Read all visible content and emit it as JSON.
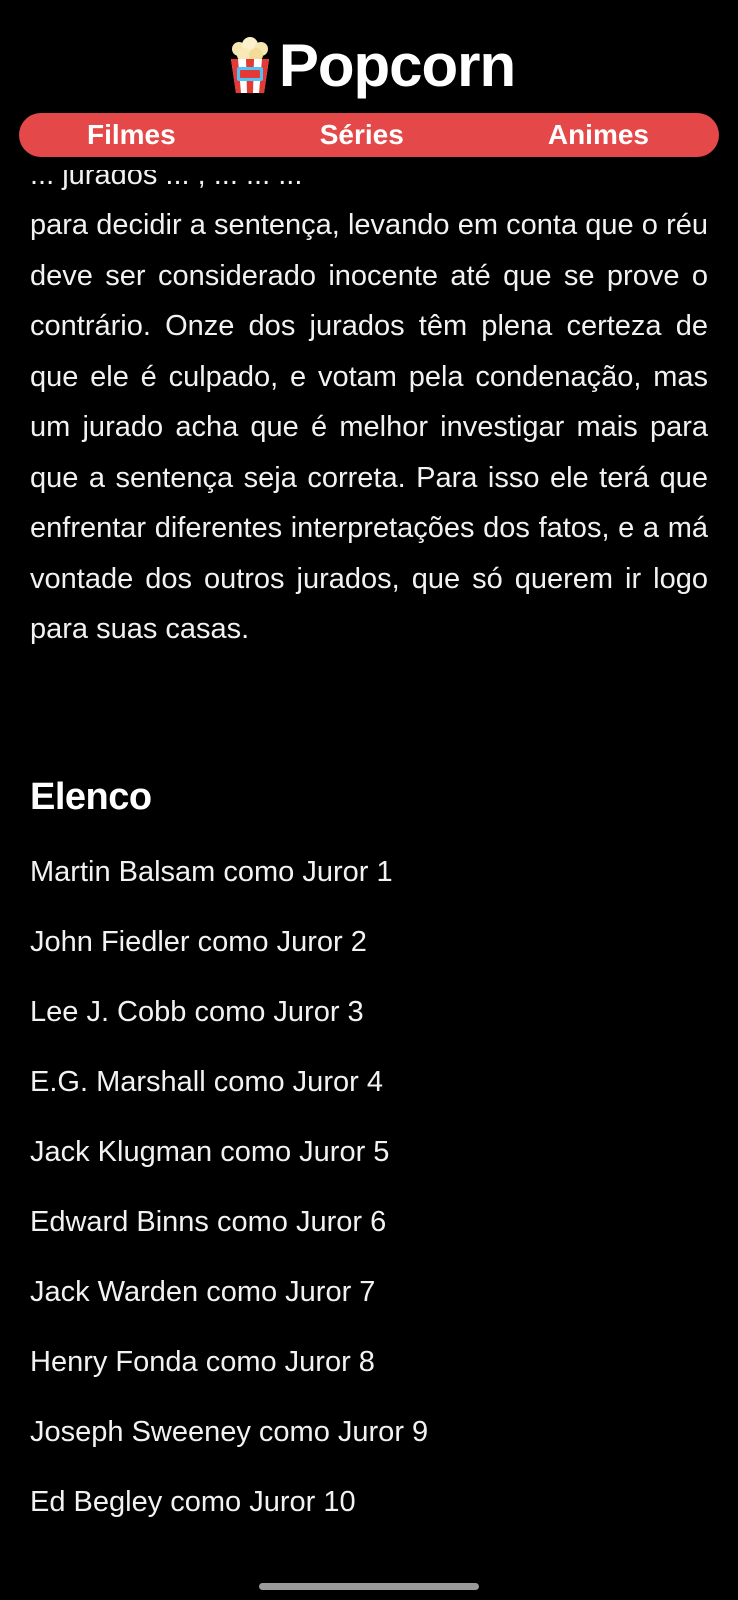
{
  "header": {
    "app_name": "Popcorn",
    "logo_icon": "popcorn-bucket-icon"
  },
  "nav": {
    "items": [
      {
        "label": "Filmes"
      },
      {
        "label": "Séries"
      },
      {
        "label": "Animes"
      }
    ]
  },
  "synopsis": {
    "partial_line": "... jurados ... , ... ... ...",
    "text": "para decidir a sentença, levando em conta que o réu deve ser considerado inocente até que se prove o contrário. Onze dos jurados têm plena certeza de que ele é culpado, e votam pela condenação, mas um jurado acha que é melhor investigar mais para que a sentença seja correta. Para isso ele terá que enfrentar diferentes interpretações dos fatos, e a má vontade dos outros jurados, que só querem ir logo para suas casas."
  },
  "cast": {
    "title": "Elenco",
    "members": [
      "Martin Balsam como Juror 1",
      "John Fiedler como Juror 2",
      "Lee J. Cobb como Juror 3",
      "E.G. Marshall como Juror 4",
      "Jack Klugman como Juror 5",
      "Edward Binns como Juror 6",
      "Jack Warden como Juror 7",
      "Henry Fonda como Juror 8",
      "Joseph Sweeney como Juror 9",
      "Ed Begley como Juror 10"
    ]
  },
  "colors": {
    "background": "#000000",
    "accent": "#e54848",
    "text": "#ffffff"
  }
}
